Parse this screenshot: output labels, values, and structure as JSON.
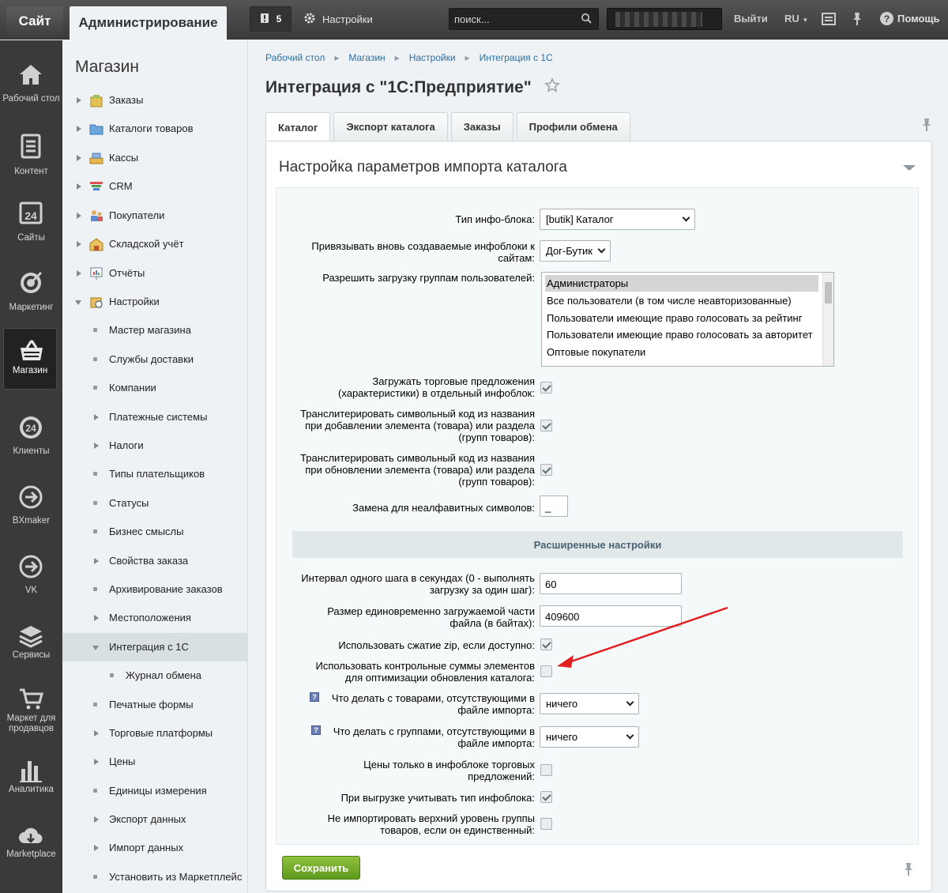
{
  "topbar": {
    "site_label": "Сайт",
    "admin_label": "Администрирование",
    "notifications_count": "5",
    "settings_label": "Настройки",
    "search_placeholder": "поиск...",
    "exit_label": "Выйти",
    "lang_label": "RU",
    "help_label": "Помощь"
  },
  "rail": [
    {
      "label": "Рабочий стол",
      "icon": "home-icon"
    },
    {
      "label": "Контент",
      "icon": "document-icon"
    },
    {
      "label": "Сайты",
      "icon": "calendar-24-icon"
    },
    {
      "label": "Маркетинг",
      "icon": "target-icon"
    },
    {
      "label": "Магазин",
      "icon": "basket-icon",
      "active": true
    },
    {
      "label": "Клиенты",
      "icon": "clients-24-icon"
    },
    {
      "label": "BXmaker",
      "icon": "arrow-circle-icon"
    },
    {
      "label": "VK",
      "icon": "arrow-circle-icon"
    },
    {
      "label": "Сервисы",
      "icon": "layers-icon"
    },
    {
      "label": "Маркет для продавцов",
      "icon": "cart-icon"
    },
    {
      "label": "Аналитика",
      "icon": "bar-chart-icon"
    },
    {
      "label": "Marketplace",
      "icon": "cloud-download-icon"
    }
  ],
  "menu": {
    "title": "Магазин",
    "items": [
      {
        "label": "Заказы"
      },
      {
        "label": "Каталоги товаров"
      },
      {
        "label": "Кассы"
      },
      {
        "label": "CRM"
      },
      {
        "label": "Покупатели"
      },
      {
        "label": "Складской учёт"
      },
      {
        "label": "Отчёты"
      },
      {
        "label": "Настройки"
      },
      {
        "label": "Мастер магазина"
      },
      {
        "label": "Службы доставки"
      },
      {
        "label": "Компании"
      },
      {
        "label": "Платежные системы"
      },
      {
        "label": "Налоги"
      },
      {
        "label": "Типы плательщиков"
      },
      {
        "label": "Статусы"
      },
      {
        "label": "Бизнес смыслы"
      },
      {
        "label": "Свойства заказа"
      },
      {
        "label": "Архивирование заказов"
      },
      {
        "label": "Местоположения"
      },
      {
        "label": "Интеграция с 1С"
      },
      {
        "label": "Журнал обмена"
      },
      {
        "label": "Печатные формы"
      },
      {
        "label": "Торговые платформы"
      },
      {
        "label": "Цены"
      },
      {
        "label": "Единицы измерения"
      },
      {
        "label": "Экспорт данных"
      },
      {
        "label": "Импорт данных"
      },
      {
        "label": "Установить из Маркетплейс"
      }
    ]
  },
  "breadcrumb": [
    "Рабочий стол",
    "Магазин",
    "Настройки",
    "Интеграция с 1С"
  ],
  "page_title": "Интеграция с \"1С:Предприятие\"",
  "tabs": [
    "Каталог",
    "Экспорт каталога",
    "Заказы",
    "Профили обмена"
  ],
  "panel_title": "Настройка параметров импорта каталога",
  "form": {
    "iblock_type_label": "Тип инфо-блока:",
    "iblock_type_value": "[butik] Каталог",
    "bind_sites_label": "Привязывать вновь создаваемые инфоблоки к сайтам:",
    "bind_sites_label_1": "Привязывать вновь создаваемые инфоблоки к",
    "bind_sites_label_2": "сайтам:",
    "bind_sites_value": "Дог-Бутик",
    "groups_label": "Разрешить загрузку группам пользователей:",
    "groups_options": [
      "Администраторы",
      "Все пользователи (в том числе неавторизованные)",
      "Пользователи имеющие право голосовать за рейтинг",
      "Пользователи имеющие право голосовать за авторитет",
      "Оптовые покупатели"
    ],
    "offers_label_1": "Загружать торговые предложения",
    "offers_label_2": "(характеристики) в отдельный инфоблок:",
    "translit_add_label_1": "Транслитерировать символьный код из названия",
    "translit_add_label_2": "при добавлении элемента (товара) или раздела",
    "translit_add_label_3": "(групп товаров):",
    "translit_upd_label_1": "Транслитерировать символьный код из названия",
    "translit_upd_label_2": "при обновлении элемента (товара) или раздела",
    "translit_upd_label_3": "(групп товаров):",
    "replace_label": "Замена для неалфавитных символов:",
    "replace_value": "_",
    "advanced_header": "Расширенные настройки",
    "interval_label_1": "Интервал одного шага в секундах (0 - выполнять",
    "interval_label_2": "загрузку за один шаг):",
    "interval_value": "60",
    "chunk_label_1": "Размер единовременно загружаемой части",
    "chunk_label_2": "файла (в байтах):",
    "chunk_value": "409600",
    "zip_label": "Использовать сжатие zip, если доступно:",
    "checksum_label_1": "Использовать контрольные суммы элементов",
    "checksum_label_2": "для оптимизации обновления каталога:",
    "missing_goods_label_1": "Что делать с товарами, отсутствующими в",
    "missing_goods_label_2": "файле импорта:",
    "missing_goods_value": "ничего",
    "missing_groups_label_1": "Что делать с группами, отсутствующими в",
    "missing_groups_label_2": "файле импорта:",
    "missing_groups_value": "ничего",
    "prices_only_label_1": "Цены только в инфоблоке торговых",
    "prices_only_label_2": "предложений:",
    "iblock_type_export_label": "При выгрузке учитывать тип инфоблока:",
    "skip_top_label_1": "Не импортировать верхний уровень группы",
    "skip_top_label_2": "товаров, если он единственный:",
    "checkboxes": {
      "offers": true,
      "translit_add": true,
      "translit_upd": true,
      "zip": true,
      "checksum": false,
      "prices_only": false,
      "iblock_type_export": true,
      "skip_top": false
    }
  },
  "save_label": "Сохранить",
  "colors": {
    "accent_green": "#6aa524",
    "link_blue": "#2b6ea4",
    "annotation_red": "#e02020"
  }
}
